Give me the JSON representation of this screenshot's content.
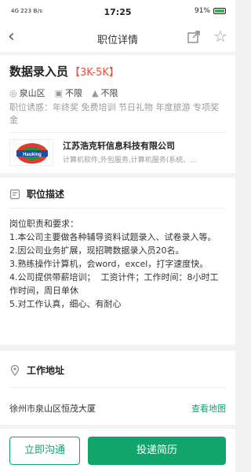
{
  "status_bar": {
    "signal": "4G",
    "net_speed": "223 B/s",
    "time": "17:25",
    "battery": "91%"
  },
  "nav": {
    "title": "职位详情"
  },
  "job": {
    "title": "数据录入员",
    "salary": "【3K-5K】",
    "location": "泉山区",
    "experience": "不限",
    "education": "不限",
    "perks": "职位诱惑：年终奖 免费培训 节日礼物 年度旅游 专项奖金"
  },
  "company": {
    "logo_text": "Hauking",
    "name": "江苏浩克轩信息科技有限公司",
    "info": "计算机软件,外包服务,计算机服务(系统、..."
  },
  "description": {
    "heading": "职位描述",
    "lines": [
      "岗位职责和要求：",
      "1.本公司主要做各种辅导资料试题录入、试卷录入等。",
      "2.因公司业务扩展，现招聘数据录入员20名。",
      "3.熟练操作计算机，会word，excel，打字速度快。",
      "4.公司提供带薪培训；  工资计件；工作时间：8小时工作时间，周日单休",
      "5.对工作认真，细心、有耐心"
    ]
  },
  "address": {
    "heading": "工作地址",
    "text": "徐州市泉山区恒茂大厦",
    "map_link": "查看地图"
  },
  "actions": {
    "chat": "立即沟通",
    "apply": "投递简历"
  },
  "colors": {
    "accent": "#12a46d",
    "salary": "#e94b3c"
  }
}
